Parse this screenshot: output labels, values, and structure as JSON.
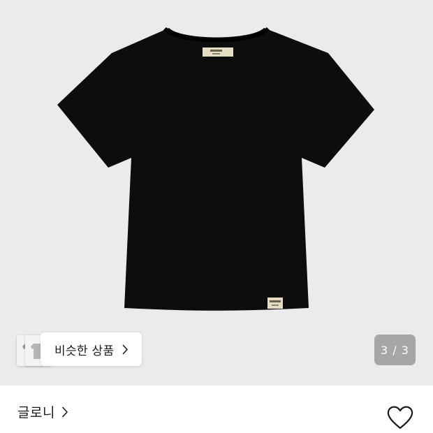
{
  "similar_products": {
    "label": "비슷한 상품"
  },
  "image_counter": {
    "text": "3 / 3",
    "current": 3,
    "total": 3
  },
  "brand": {
    "name": "글로니"
  },
  "colors": {
    "gallery_background": "#ebebeb",
    "tshirt": "#0d0d0d",
    "label_tag": "#e6dcc4",
    "counter_background": "#8a8a8a",
    "text_primary": "#1a1a1a"
  },
  "icons": {
    "similar_chevron": "chevron-right-icon",
    "brand_chevron": "chevron-right-icon",
    "favorite": "heart-outline-icon"
  }
}
